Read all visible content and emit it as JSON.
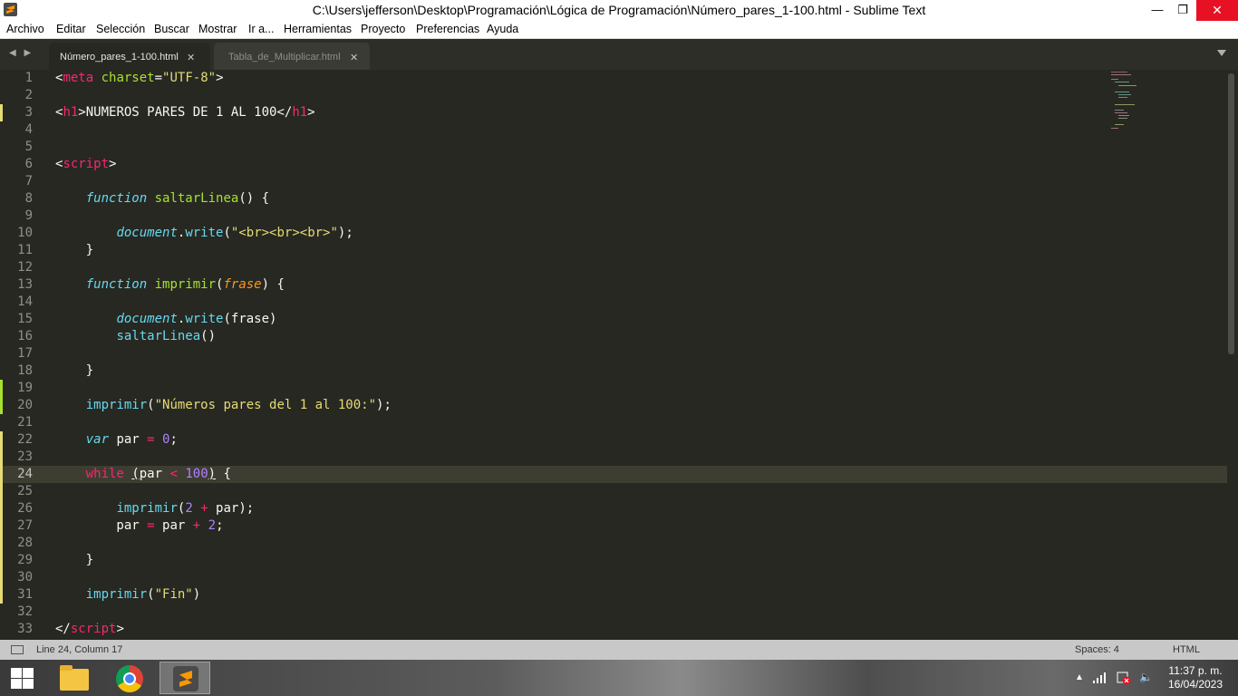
{
  "window": {
    "title": "C:\\Users\\jefferson\\Desktop\\Programación\\Lógica de Programación\\Número_pares_1-100.html - Sublime Text",
    "minimize": "—",
    "maximize": "❐",
    "close": "✕"
  },
  "menu": [
    "Archivo",
    "Editar",
    "Selección",
    "Buscar",
    "Mostrar",
    "Ir a...",
    "Herramientas",
    "Proyecto",
    "Preferencias",
    "Ayuda"
  ],
  "tabs": [
    {
      "label": "Número_pares_1-100.html",
      "close": "✕"
    },
    {
      "label": "Tabla_de_Multiplicar.html",
      "close": "✕"
    }
  ],
  "tab_nav": "◀ ▶",
  "editor": {
    "current_line": 24,
    "lines": [
      {
        "n": "1",
        "tokens": [
          [
            "t-plain",
            "<"
          ],
          [
            "t-tag",
            "meta"
          ],
          [
            "t-plain",
            " "
          ],
          [
            "t-attr",
            "charset"
          ],
          [
            "t-plain",
            "="
          ],
          [
            "t-str",
            "\"UTF-8\""
          ],
          [
            "t-plain",
            ">"
          ]
        ]
      },
      {
        "n": "2",
        "tokens": []
      },
      {
        "n": "3",
        "tokens": [
          [
            "t-plain",
            "<"
          ],
          [
            "t-tag",
            "h1"
          ],
          [
            "t-plain",
            ">NUMEROS PARES DE 1 AL 100</"
          ],
          [
            "t-tag",
            "h1"
          ],
          [
            "t-plain",
            ">"
          ]
        ]
      },
      {
        "n": "4",
        "tokens": []
      },
      {
        "n": "5",
        "tokens": []
      },
      {
        "n": "6",
        "tokens": [
          [
            "t-plain",
            "<"
          ],
          [
            "t-tag",
            "script"
          ],
          [
            "t-plain",
            ">"
          ]
        ]
      },
      {
        "n": "7",
        "tokens": []
      },
      {
        "n": "8",
        "tokens": [
          [
            "t-plain",
            "    "
          ],
          [
            "t-stor",
            "function"
          ],
          [
            "t-plain",
            " "
          ],
          [
            "t-func",
            "saltarLinea"
          ],
          [
            "t-plain",
            "() {"
          ]
        ]
      },
      {
        "n": "9",
        "tokens": []
      },
      {
        "n": "10",
        "tokens": [
          [
            "t-plain",
            "        "
          ],
          [
            "t-stor",
            "document"
          ],
          [
            "t-plain",
            "."
          ],
          [
            "t-call",
            "write"
          ],
          [
            "t-plain",
            "("
          ],
          [
            "t-str",
            "\"<br><br><br>\""
          ],
          [
            "t-plain",
            ");"
          ]
        ]
      },
      {
        "n": "11",
        "tokens": [
          [
            "t-plain",
            "    }"
          ]
        ]
      },
      {
        "n": "12",
        "tokens": []
      },
      {
        "n": "13",
        "tokens": [
          [
            "t-plain",
            "    "
          ],
          [
            "t-stor",
            "function"
          ],
          [
            "t-plain",
            " "
          ],
          [
            "t-func",
            "imprimir"
          ],
          [
            "t-plain",
            "("
          ],
          [
            "t-param",
            "frase"
          ],
          [
            "t-plain",
            ") {"
          ]
        ]
      },
      {
        "n": "14",
        "tokens": []
      },
      {
        "n": "15",
        "tokens": [
          [
            "t-plain",
            "        "
          ],
          [
            "t-stor",
            "document"
          ],
          [
            "t-plain",
            "."
          ],
          [
            "t-call",
            "write"
          ],
          [
            "t-plain",
            "(frase)"
          ]
        ]
      },
      {
        "n": "16",
        "tokens": [
          [
            "t-plain",
            "        "
          ],
          [
            "t-call",
            "saltarLinea"
          ],
          [
            "t-plain",
            "()"
          ]
        ]
      },
      {
        "n": "17",
        "tokens": []
      },
      {
        "n": "18",
        "tokens": [
          [
            "t-plain",
            "    }"
          ]
        ]
      },
      {
        "n": "19",
        "tokens": []
      },
      {
        "n": "20",
        "tokens": [
          [
            "t-plain",
            "    "
          ],
          [
            "t-call",
            "imprimir"
          ],
          [
            "t-plain",
            "("
          ],
          [
            "t-str",
            "\"Números pares del 1 al 100:\""
          ],
          [
            "t-plain",
            ");"
          ]
        ]
      },
      {
        "n": "21",
        "tokens": []
      },
      {
        "n": "22",
        "tokens": [
          [
            "t-plain",
            "    "
          ],
          [
            "t-stor",
            "var"
          ],
          [
            "t-plain",
            " par "
          ],
          [
            "t-op",
            "="
          ],
          [
            "t-plain",
            " "
          ],
          [
            "t-num",
            "0"
          ],
          [
            "t-plain",
            ";"
          ]
        ]
      },
      {
        "n": "23",
        "tokens": []
      },
      {
        "n": "24",
        "tokens": [
          [
            "t-plain",
            "    "
          ],
          [
            "t-kw",
            "while"
          ],
          [
            "t-plain",
            " "
          ],
          [
            "t-ul",
            "("
          ],
          [
            "t-plain",
            "par "
          ],
          [
            "t-op",
            "<"
          ],
          [
            "t-plain",
            " "
          ],
          [
            "t-num",
            "100"
          ],
          [
            "t-ul",
            ")"
          ],
          [
            "t-plain",
            " {"
          ]
        ]
      },
      {
        "n": "25",
        "tokens": []
      },
      {
        "n": "26",
        "tokens": [
          [
            "t-plain",
            "        "
          ],
          [
            "t-call",
            "imprimir"
          ],
          [
            "t-plain",
            "("
          ],
          [
            "t-num",
            "2"
          ],
          [
            "t-plain",
            " "
          ],
          [
            "t-op",
            "+"
          ],
          [
            "t-plain",
            " par);"
          ]
        ]
      },
      {
        "n": "27",
        "tokens": [
          [
            "t-plain",
            "        par "
          ],
          [
            "t-op",
            "="
          ],
          [
            "t-plain",
            " par "
          ],
          [
            "t-op",
            "+"
          ],
          [
            "t-plain",
            " "
          ],
          [
            "t-num",
            "2"
          ],
          [
            "t-plain",
            ";"
          ]
        ]
      },
      {
        "n": "28",
        "tokens": []
      },
      {
        "n": "29",
        "tokens": [
          [
            "t-plain",
            "    }"
          ]
        ]
      },
      {
        "n": "30",
        "tokens": []
      },
      {
        "n": "31",
        "tokens": [
          [
            "t-plain",
            "    "
          ],
          [
            "t-call",
            "imprimir"
          ],
          [
            "t-plain",
            "("
          ],
          [
            "t-str",
            "\"Fin\""
          ],
          [
            "t-plain",
            ")"
          ]
        ]
      },
      {
        "n": "32",
        "tokens": []
      },
      {
        "n": "33",
        "tokens": [
          [
            "t-plain",
            "</"
          ],
          [
            "t-tag",
            "script"
          ],
          [
            "t-plain",
            ">"
          ]
        ]
      }
    ],
    "modified_lines": {
      "3": "#e6db74",
      "19": "#a6e22e",
      "20": "#a6e22e",
      "22": "#e6db74",
      "23": "#e6db74",
      "24": "#e6db74",
      "25": "#e6db74",
      "26": "#e6db74",
      "27": "#e6db74",
      "28": "#e6db74",
      "29": "#e6db74",
      "30": "#e6db74",
      "31": "#e6db74"
    }
  },
  "status": {
    "position": "Line 24, Column 17",
    "spaces": "Spaces: 4",
    "syntax": "HTML"
  },
  "taskbar": {
    "time": "11:37 p. m.",
    "date": "16/04/2023",
    "tray_up": "▲",
    "tray_volume": "🔈"
  },
  "colors": {
    "editor_bg": "#272822",
    "accent_close": "#e81123",
    "keyword": "#f92672",
    "function": "#a6e22e",
    "string": "#e6db74",
    "storage": "#66d9ef",
    "number": "#ae81ff"
  }
}
